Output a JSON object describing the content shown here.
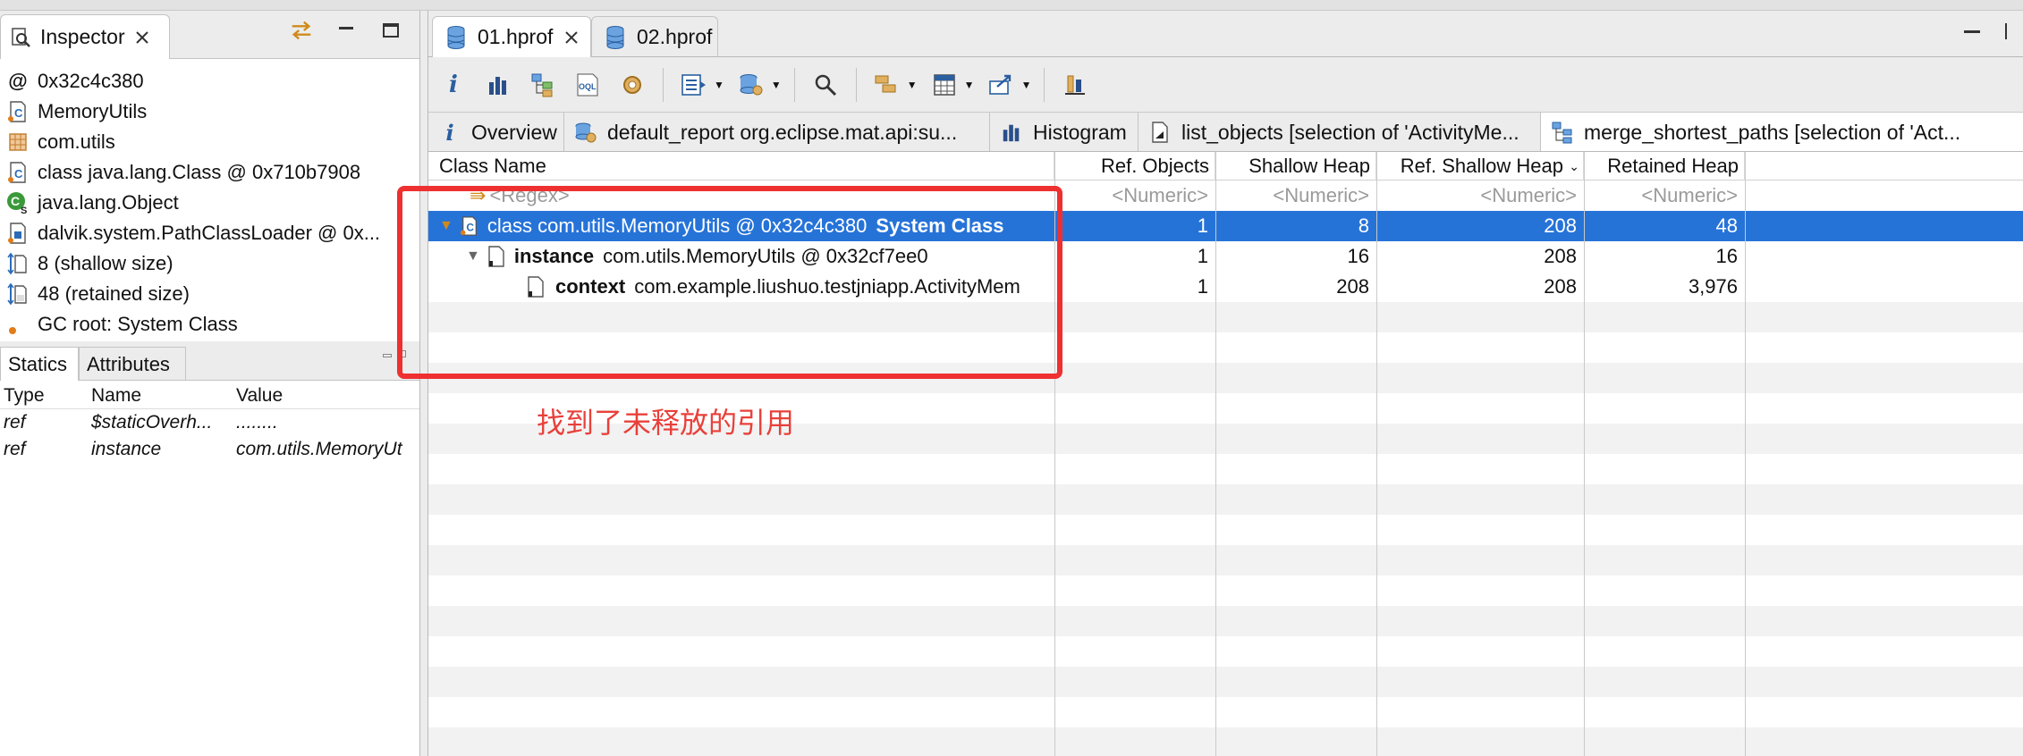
{
  "inspector": {
    "tab_label": "Inspector",
    "properties": [
      {
        "icon": "at-icon",
        "text": "0x32c4c380"
      },
      {
        "icon": "class-icon",
        "text": "MemoryUtils"
      },
      {
        "icon": "package-icon",
        "text": "com.utils"
      },
      {
        "icon": "class-icon",
        "text": "class java.lang.Class @ 0x710b7908"
      },
      {
        "icon": "superclass-icon",
        "text": "java.lang.Object"
      },
      {
        "icon": "classloader-icon",
        "text": "dalvik.system.PathClassLoader @ 0x..."
      },
      {
        "icon": "shallow-size-icon",
        "text": "8 (shallow size)"
      },
      {
        "icon": "retained-size-icon",
        "text": "48 (retained size)"
      },
      {
        "icon": "gc-root-icon",
        "text": "GC root: System Class"
      }
    ],
    "sub_tabs": [
      "Statics",
      "Attributes"
    ],
    "attributes": {
      "columns": [
        "Type",
        "Name",
        "Value"
      ],
      "rows": [
        {
          "type": "ref",
          "name": "$staticOverh...",
          "value": "........"
        },
        {
          "type": "ref",
          "name": "instance",
          "value": "com.utils.MemoryUt"
        }
      ]
    }
  },
  "editor": {
    "file_tabs": [
      "01.hprof",
      "02.hprof"
    ],
    "view_tabs": [
      "Overview",
      "default_report  org.eclipse.mat.api:su...",
      "Histogram",
      "list_objects [selection of 'ActivityMe...",
      "merge_shortest_paths [selection of 'Act..."
    ],
    "table": {
      "columns": [
        "Class Name",
        "Ref. Objects",
        "Shallow Heap",
        "Ref. Shallow Heap",
        "Retained Heap"
      ],
      "filter_row": {
        "name": "<Regex>",
        "numeric": "<Numeric>"
      },
      "rows": [
        {
          "bold": "class com.utils.MemoryUtils @ 0x32c4c380",
          "rest": "System Class",
          "ref_objects": "1",
          "shallow": "8",
          "ref_shallow": "208",
          "retained": "48"
        },
        {
          "bold": "instance",
          "rest": "com.utils.MemoryUtils @ 0x32cf7ee0",
          "ref_objects": "1",
          "shallow": "16",
          "ref_shallow": "208",
          "retained": "16"
        },
        {
          "bold": "context",
          "rest": "com.example.liushuo.testjniapp.ActivityMem",
          "ref_objects": "1",
          "shallow": "208",
          "ref_shallow": "208",
          "retained": "3,976"
        }
      ]
    }
  },
  "annotation": "找到了未释放的引用",
  "colors": {
    "selection": "#2673d8",
    "highlight": "#ee3030",
    "annotation": "#e8403a"
  }
}
